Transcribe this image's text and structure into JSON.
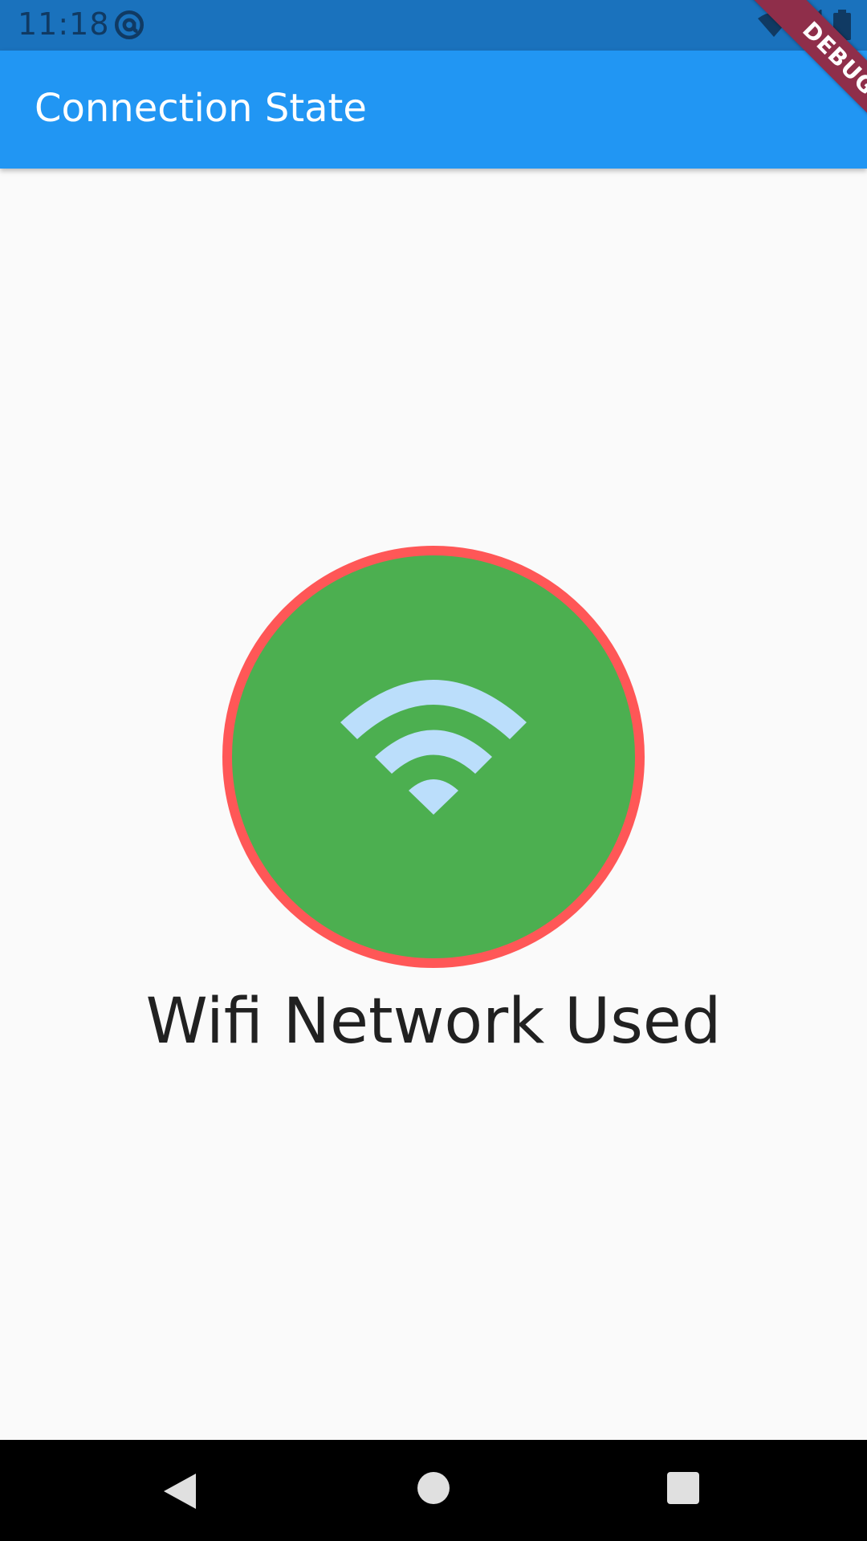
{
  "status_bar": {
    "time": "11:18",
    "icons": [
      "at-sign-icon",
      "wifi-icon",
      "signal-icon",
      "battery-icon"
    ]
  },
  "app_bar": {
    "title": "Connection State"
  },
  "debug_banner": {
    "label": "DEBUG"
  },
  "connection": {
    "icon": "wifi-icon",
    "label": "Wifi Network Used",
    "circle_color": "#4caf50",
    "ring_color": "#ff5757",
    "icon_color": "#bbdefb"
  },
  "nav_bar": {
    "buttons": [
      "back-icon",
      "home-icon",
      "recents-icon"
    ]
  },
  "colors": {
    "status_bar": "#1a72bd",
    "app_bar": "#2196f3",
    "background": "#fafafa",
    "debug": "#8f2e4a"
  }
}
